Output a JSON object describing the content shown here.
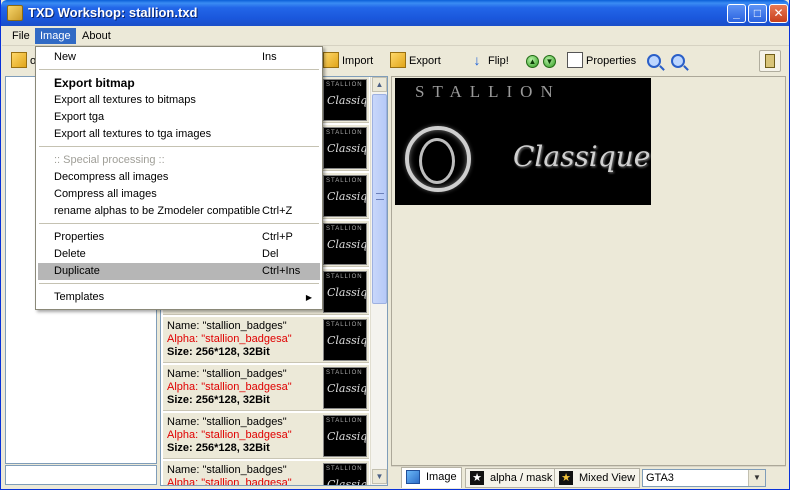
{
  "window": {
    "title": "TXD Workshop: stallion.txd",
    "minimize": "_",
    "maximize": "□",
    "close": "✕"
  },
  "menubar": {
    "file": "File",
    "image": "Image",
    "about": "About"
  },
  "toolbar": {
    "left_partial": "o",
    "import": "Import",
    "export": "Export",
    "flip": "Flip!",
    "up": "▲",
    "down": "▼",
    "properties": "Properties",
    "flip_icon": "↓"
  },
  "image_menu": {
    "new": {
      "label": "New",
      "shortcut": "Ins"
    },
    "export_bitmap": "Export bitmap",
    "export_all_bitmaps": "Export all textures to bitmaps",
    "export_tga": "Export tga",
    "export_all_tga": "Export all textures to tga images",
    "special_processing": ":: Special processing ::",
    "decompress_all": "Decompress all images",
    "compress_all": "Compress all images",
    "rename_alphas": {
      "label": "rename alphas to be Zmodeler compatible",
      "shortcut": "Ctrl+Z"
    },
    "properties": {
      "label": "Properties",
      "shortcut": "Ctrl+P"
    },
    "delete": {
      "label": "Delete",
      "shortcut": "Del"
    },
    "duplicate": {
      "label": "Duplicate",
      "shortcut": "Ctrl+Ins"
    },
    "templates": {
      "label": "Templates",
      "arrow": "▶"
    }
  },
  "texture_list": {
    "items": [
      {
        "name": "Name: \"stallion_badges\"",
        "alpha": "Alpha: \"stallion_badgesa\"",
        "size": "Size: 256*128, 32Bit"
      },
      {
        "name": "Name: \"stallion_badges\"",
        "alpha": "Alpha: \"stallion_badgesa\"",
        "size": "Size: 256*128, 32Bit"
      },
      {
        "name": "Name: \"stallion_badges\"",
        "alpha": "Alpha: \"stallion_badgesa\"",
        "size": "Size: 256*128, 32Bit"
      },
      {
        "name": "Name: \"stallion_badges\"",
        "alpha": "Alpha: \"stallion_badgesa\"",
        "size": ""
      }
    ],
    "thumb_top": "STALLION",
    "thumb_script": "Classique"
  },
  "preview": {
    "top_text": "STALLION",
    "script_text": "Classique"
  },
  "view_tabs": {
    "image": "Image",
    "alpha": "alpha / mask",
    "mixed": "Mixed View"
  },
  "game_select": {
    "value": "GTA3"
  },
  "colors": {
    "titlebar": "#2266E8",
    "menu_highlight": "#316AC5",
    "alpha_text": "#e00000",
    "face": "#ECE9D8"
  }
}
